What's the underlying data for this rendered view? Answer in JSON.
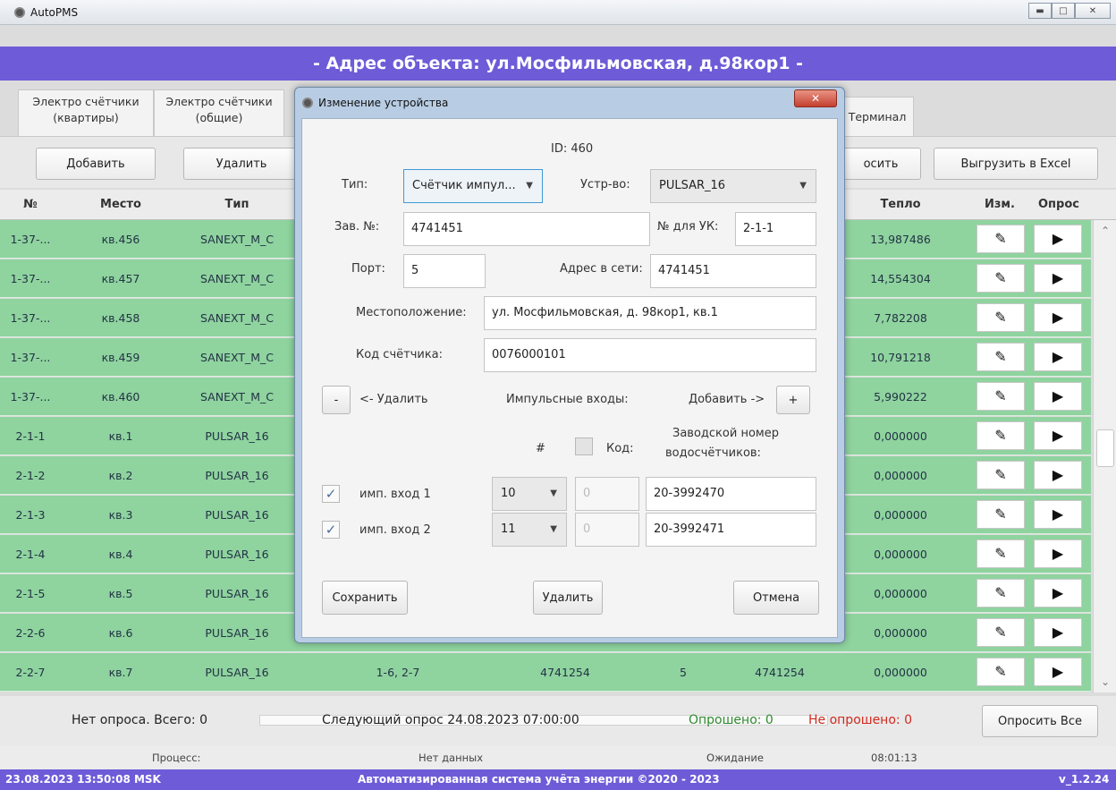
{
  "window": {
    "title": "AutoPMS"
  },
  "header": {
    "address": "- Адрес объекта: ул.Мосфильмовская, д.98кор1 -"
  },
  "tabs": [
    {
      "label": "Электро счётчики (квартиры)"
    },
    {
      "label": "Электро счётчики (общие)"
    },
    {
      "label": "Терминал"
    }
  ],
  "toolbar": {
    "add": "Добавить",
    "delete": "Удалить",
    "poll": "осить",
    "export": "Выгрузить в Excel"
  },
  "table": {
    "columns": [
      "№",
      "Место",
      "Тип",
      "Тепло",
      "Изм.",
      "Опрос"
    ],
    "rows": [
      {
        "num": "1-37-...",
        "place": "кв.456",
        "type": "SANEXT_M_C",
        "heat": "13,987486"
      },
      {
        "num": "1-37-...",
        "place": "кв.457",
        "type": "SANEXT_M_C",
        "heat": "14,554304"
      },
      {
        "num": "1-37-...",
        "place": "кв.458",
        "type": "SANEXT_M_C",
        "heat": "7,782208"
      },
      {
        "num": "1-37-...",
        "place": "кв.459",
        "type": "SANEXT_M_C",
        "heat": "10,791218"
      },
      {
        "num": "1-37-...",
        "place": "кв.460",
        "type": "SANEXT_M_C",
        "heat": "5,990222"
      },
      {
        "num": "2-1-1",
        "place": "кв.1",
        "type": "PULSAR_16",
        "heat": "0,000000"
      },
      {
        "num": "2-1-2",
        "place": "кв.2",
        "type": "PULSAR_16",
        "heat": "0,000000"
      },
      {
        "num": "2-1-3",
        "place": "кв.3",
        "type": "PULSAR_16",
        "heat": "0,000000"
      },
      {
        "num": "2-1-4",
        "place": "кв.4",
        "type": "PULSAR_16",
        "heat": "0,000000"
      },
      {
        "num": "2-1-5",
        "place": "кв.5",
        "type": "PULSAR_16",
        "heat": "0,000000"
      },
      {
        "num": "2-2-6",
        "place": "кв.6",
        "type": "PULSAR_16",
        "heat": "0,000000"
      },
      {
        "num": "2-2-7",
        "place": "кв.7",
        "type": "PULSAR_16",
        "heat": "0,000000",
        "inputs": "1-6, 2-7",
        "serial": "4741254",
        "port": "5",
        "netaddr": "4741254"
      }
    ],
    "edit_glyph": "✎",
    "run_glyph": "▶"
  },
  "status": {
    "no_poll": "Нет опроса. Всего: 0",
    "next_poll": "Следующий опрос 24.08.2023 07:00:00",
    "polled": "Опрошено: 0",
    "not_polled": "Не опрошено: 0",
    "poll_all": "Опросить Все",
    "process_label": "Процесс:",
    "no_data": "Нет данных",
    "waiting": "Ожидание",
    "time": "08:01:13"
  },
  "footer": {
    "datetime": "23.08.2023 13:50:08 MSK",
    "system": "Автоматизированная система учёта энергии ©2020 - 2023",
    "version": "v_1.2.24"
  },
  "dialog": {
    "title": "Изменение устройства",
    "id": "ID: 460",
    "type_label": "Тип:",
    "type_value": "Счётчик импул...",
    "device_label": "Устр-во:",
    "device_value": "PULSAR_16",
    "serial_label": "Зав. №:",
    "serial_value": "4741451",
    "uk_label": "№ для УК:",
    "uk_value": "2-1-1",
    "port_label": "Порт:",
    "port_value": "5",
    "net_label": "Адрес в сети:",
    "net_value": "4741451",
    "location_label": "Местоположение:",
    "location_value": "ул. Мосфильмовская, д. 98кор1, кв.1",
    "code_label": "Код счётчика:",
    "code_value": "0076000101",
    "minus": "-",
    "remove_label": "<- Удалить",
    "inputs_label": "Импульсные входы:",
    "add_label": "Добавить ->",
    "plus": "+",
    "hash": "#",
    "code_col": "Код:",
    "serial_col_1": "Заводской номер",
    "serial_col_2": "водосчётчиков:",
    "inputs": [
      {
        "checked": "✓",
        "name": "имп. вход 1",
        "num": "10",
        "code": "0",
        "serial": "20-3992470"
      },
      {
        "checked": "✓",
        "name": "имп. вход 2",
        "num": "11",
        "code": "0",
        "serial": "20-3992471"
      }
    ],
    "save": "Сохранить",
    "delete": "Удалить",
    "cancel": "Отмена"
  }
}
